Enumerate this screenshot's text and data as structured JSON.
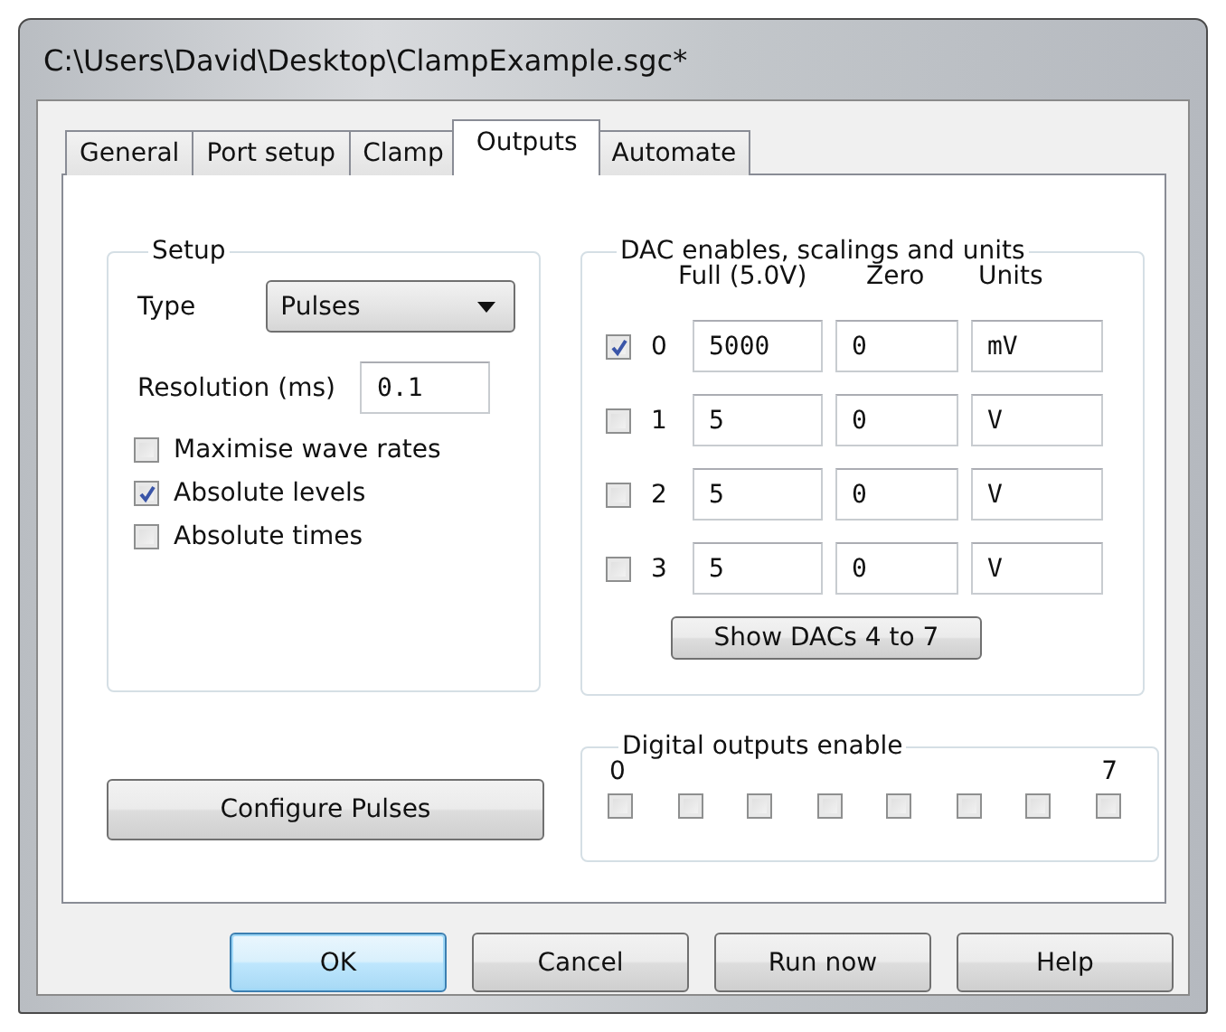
{
  "window": {
    "title": "C:\\Users\\David\\Desktop\\ClampExample.sgc*"
  },
  "tabs": [
    {
      "label": "General",
      "selected": false
    },
    {
      "label": "Port setup",
      "selected": false
    },
    {
      "label": "Clamp",
      "selected": false
    },
    {
      "label": "Outputs",
      "selected": true
    },
    {
      "label": "Automate",
      "selected": false
    }
  ],
  "setup": {
    "title": "Setup",
    "type_label": "Type",
    "type_value": "Pulses",
    "resolution_label": "Resolution (ms)",
    "resolution_value": "0.1",
    "options": [
      {
        "label": "Maximise wave rates",
        "checked": false
      },
      {
        "label": "Absolute levels",
        "checked": true
      },
      {
        "label": "Absolute times",
        "checked": false
      }
    ]
  },
  "dac": {
    "title": "DAC enables, scalings and units",
    "columns": [
      "Full (5.0V)",
      "Zero",
      "Units"
    ],
    "rows": [
      {
        "index": "0",
        "checked": true,
        "full": "5000",
        "zero": "0",
        "units": "mV"
      },
      {
        "index": "1",
        "checked": false,
        "full": "5",
        "zero": "0",
        "units": "V"
      },
      {
        "index": "2",
        "checked": false,
        "full": "5",
        "zero": "0",
        "units": "V"
      },
      {
        "index": "3",
        "checked": false,
        "full": "5",
        "zero": "0",
        "units": "V"
      }
    ],
    "button": "Show DACs 4 to 7"
  },
  "configure_button": "Configure Pulses",
  "digital": {
    "title": "Digital outputs enable",
    "first_label": "0",
    "last_label": "7",
    "outputs": [
      {
        "checked": false
      },
      {
        "checked": false
      },
      {
        "checked": false
      },
      {
        "checked": false
      },
      {
        "checked": false
      },
      {
        "checked": false
      },
      {
        "checked": false
      },
      {
        "checked": false
      }
    ]
  },
  "buttons": [
    {
      "label": "OK",
      "default": true
    },
    {
      "label": "Cancel",
      "default": false
    },
    {
      "label": "Run now",
      "default": false
    },
    {
      "label": "Help",
      "default": false
    }
  ]
}
